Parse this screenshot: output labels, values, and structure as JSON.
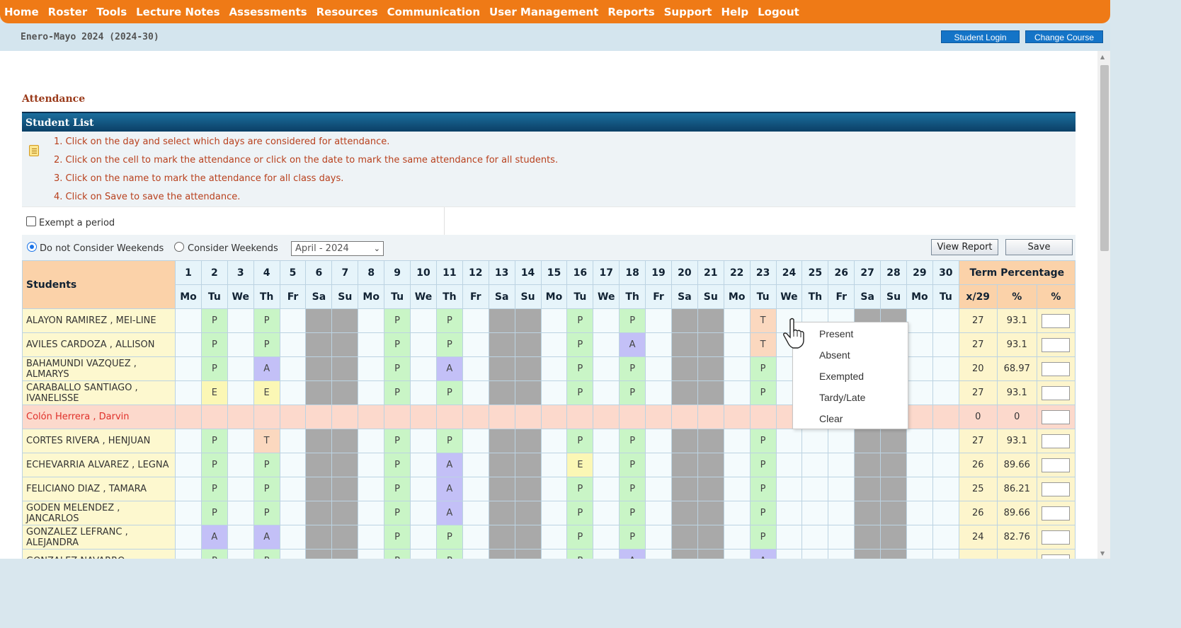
{
  "nav": [
    "Home",
    "Roster",
    "Tools",
    "Lecture Notes",
    "Assessments",
    "Resources",
    "Communication",
    "User Management",
    "Reports",
    "Support",
    "Help",
    "Logout"
  ],
  "term": "Enero-Mayo 2024 (2024-30)",
  "top_buttons": {
    "student_login": "Student Login",
    "change_course": "Change Course"
  },
  "page_title": "Attendance",
  "panel_title": "Student List",
  "instructions": [
    "1. Click on the day and select which days are considered for attendance.",
    "2. Click on the cell to mark the attendance or click on the date to mark the same attendance for all students.",
    "3. Click on the name to mark the attendance for all class days.",
    "4. Click on Save to save the attendance."
  ],
  "exempt_label": "Exempt a period",
  "weekend_options": {
    "no": "Do not Consider Weekends",
    "yes": "Consider Weekends",
    "selected": "no"
  },
  "month_select": "April - 2024",
  "buttons": {
    "view_report": "View Report",
    "save": "Save"
  },
  "grid": {
    "students_header": "Students",
    "term_header": "Term Percentage",
    "term_sub": [
      "x/29",
      "%",
      "%"
    ],
    "days": [
      "1",
      "2",
      "3",
      "4",
      "5",
      "6",
      "7",
      "8",
      "9",
      "10",
      "11",
      "12",
      "13",
      "14",
      "15",
      "16",
      "17",
      "18",
      "19",
      "20",
      "21",
      "22",
      "23",
      "24",
      "25",
      "26",
      "27",
      "28",
      "29",
      "30"
    ],
    "weekdays": [
      "Mo",
      "Tu",
      "We",
      "Th",
      "Fr",
      "Sa",
      "Su",
      "Mo",
      "Tu",
      "We",
      "Th",
      "Fr",
      "Sa",
      "Su",
      "Mo",
      "Tu",
      "We",
      "Th",
      "Fr",
      "Sa",
      "Su",
      "Mo",
      "Tu",
      "We",
      "Th",
      "Fr",
      "Sa",
      "Su",
      "Mo",
      "Tu"
    ],
    "rows": [
      {
        "name": "ALAYON RAMIREZ , MEI-LINE",
        "marks": {
          "2": "P",
          "4": "P",
          "9": "P",
          "11": "P",
          "16": "P",
          "18": "P",
          "23": "T"
        },
        "count": "27",
        "pct": "93.1"
      },
      {
        "name": "AVILES CARDOZA , ALLISON",
        "marks": {
          "2": "P",
          "4": "P",
          "9": "P",
          "11": "P",
          "16": "P",
          "18": "A",
          "23": "T"
        },
        "count": "27",
        "pct": "93.1"
      },
      {
        "name": "BAHAMUNDI VAZQUEZ , ALMARYS",
        "marks": {
          "2": "P",
          "4": "A",
          "9": "P",
          "11": "A",
          "16": "P",
          "18": "P",
          "23": "P"
        },
        "count": "20",
        "pct": "68.97"
      },
      {
        "name": "CARABALLO SANTIAGO , IVANELISSE",
        "marks": {
          "2": "E",
          "4": "E",
          "9": "P",
          "11": "P",
          "16": "P",
          "18": "P",
          "23": "P"
        },
        "count": "27",
        "pct": "93.1"
      },
      {
        "name": "Colón Herrera , Darvin",
        "marks": {},
        "count": "0",
        "pct": "0",
        "inactive": true
      },
      {
        "name": "CORTES RIVERA , HENJUAN",
        "marks": {
          "2": "P",
          "4": "T",
          "9": "P",
          "11": "P",
          "16": "P",
          "18": "P",
          "23": "P"
        },
        "count": "27",
        "pct": "93.1"
      },
      {
        "name": "ECHEVARRIA ALVAREZ , LEGNA",
        "marks": {
          "2": "P",
          "4": "P",
          "9": "P",
          "11": "A",
          "16": "E",
          "18": "P",
          "23": "P"
        },
        "count": "26",
        "pct": "89.66"
      },
      {
        "name": "FELICIANO DIAZ , TAMARA",
        "marks": {
          "2": "P",
          "4": "P",
          "9": "P",
          "11": "A",
          "16": "P",
          "18": "P",
          "23": "P"
        },
        "count": "25",
        "pct": "86.21"
      },
      {
        "name": "GODEN MELENDEZ , JANCARLOS",
        "marks": {
          "2": "P",
          "4": "P",
          "9": "P",
          "11": "A",
          "16": "P",
          "18": "P",
          "23": "P"
        },
        "count": "26",
        "pct": "89.66"
      },
      {
        "name": "GONZALEZ LEFRANC , ALEJANDRA",
        "marks": {
          "2": "A",
          "4": "A",
          "9": "P",
          "11": "P",
          "16": "P",
          "18": "P",
          "23": "P"
        },
        "count": "24",
        "pct": "82.76"
      },
      {
        "name": "GONZALEZ NAVARRO",
        "marks": {
          "2": "P",
          "4": "P",
          "9": "P",
          "11": "P",
          "16": "P",
          "18": "A",
          "23": "A"
        },
        "count": "",
        "pct": ""
      }
    ]
  },
  "context_menu": [
    "Present",
    "Absent",
    "Exempted",
    "Tardy/Late",
    "Clear"
  ]
}
